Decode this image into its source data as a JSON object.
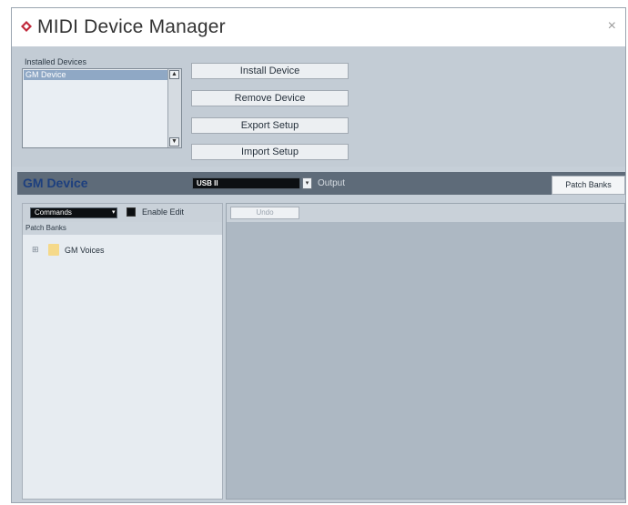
{
  "window": {
    "title": "MIDI Device Manager",
    "close_glyph": "×",
    "app_icon": "cubase-diamond-icon",
    "accent_color": "#c0283a"
  },
  "installed_devices": {
    "label": "Installed Devices",
    "items": [
      "GM Device"
    ],
    "selected": "GM Device",
    "scroll_up_glyph": "▲",
    "scroll_down_glyph": "▼"
  },
  "buttons": {
    "install": "Install Device",
    "remove": "Remove Device",
    "export": "Export Setup",
    "import": "Import Setup"
  },
  "device_bar": {
    "device_name": "GM Device",
    "output_value": "USB II",
    "output_label": "Output",
    "tab_label": "Patch Banks",
    "dropdown_glyph": "▾"
  },
  "left_panel": {
    "commands_value": "Commands",
    "commands_arrow": "▾",
    "enable_edit_label": "Enable Edit",
    "patch_banks_header": "Patch Banks",
    "tree": [
      {
        "expander": "⊞",
        "label": "GM Voices"
      }
    ]
  },
  "right_panel": {
    "undo_label": "Undo"
  }
}
